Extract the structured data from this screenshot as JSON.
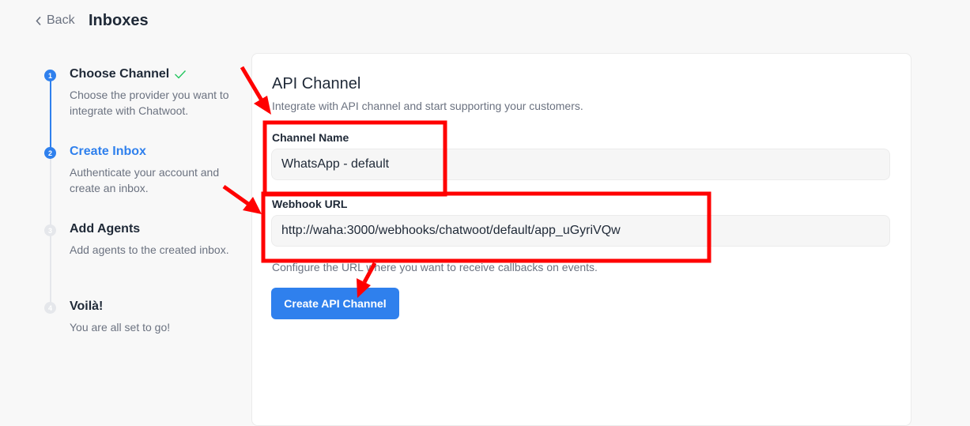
{
  "header": {
    "back_label": "Back",
    "title": "Inboxes"
  },
  "steps": [
    {
      "number": "1",
      "title": "Choose Channel",
      "description": "Choose the provider you want to integrate with Chatwoot.",
      "state": "done"
    },
    {
      "number": "2",
      "title": "Create Inbox",
      "description": "Authenticate your account and create an inbox.",
      "state": "current"
    },
    {
      "number": "3",
      "title": "Add Agents",
      "description": "Add agents to the created inbox.",
      "state": "pending"
    },
    {
      "number": "4",
      "title": "Voilà!",
      "description": "You are all set to go!",
      "state": "pending"
    }
  ],
  "form": {
    "title": "API Channel",
    "subtitle": "Integrate with API channel and start supporting your customers.",
    "channel_name_label": "Channel Name",
    "channel_name_value": "WhatsApp - default",
    "webhook_label": "Webhook URL",
    "webhook_value": "http://waha:3000/webhooks/chatwoot/default/app_uGyriVQw",
    "webhook_help": "Configure the URL where you want to receive callbacks on events.",
    "submit_label": "Create API Channel"
  },
  "colors": {
    "accent": "#2f80ed",
    "annotation": "#ff0000",
    "check": "#22c55e"
  },
  "icons": {
    "back": "chevron-left-icon",
    "done": "check-icon"
  }
}
